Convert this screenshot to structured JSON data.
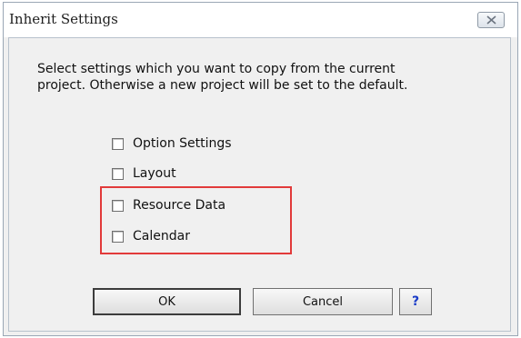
{
  "window": {
    "title": "Inherit Settings",
    "close_icon": "close-icon"
  },
  "description": {
    "line1": "Select settings which you want to copy from the current",
    "line2": "project. Otherwise a new project will be set to the default."
  },
  "options": [
    {
      "label": "Option Settings",
      "checked": false
    },
    {
      "label": "Layout",
      "checked": false
    },
    {
      "label": "Resource Data",
      "checked": false
    },
    {
      "label": "Calendar",
      "checked": false
    }
  ],
  "highlight_color": "#e23a3a",
  "buttons": {
    "ok": "OK",
    "cancel": "Cancel",
    "help": "?"
  }
}
